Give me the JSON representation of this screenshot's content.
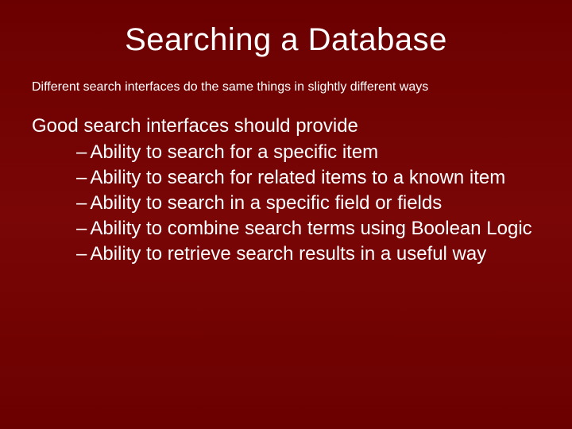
{
  "title": "Searching a Database",
  "subtitle": "Different search interfaces do the same things in slightly different ways",
  "lead": "Good search interfaces should provide",
  "bullets": [
    "Ability to search for a specific item",
    "Ability to search for related items to a known item",
    "Ability to search in a specific field or fields",
    "Ability to combine search terms using Boolean Logic",
    "Ability to retrieve search results in a useful way"
  ]
}
